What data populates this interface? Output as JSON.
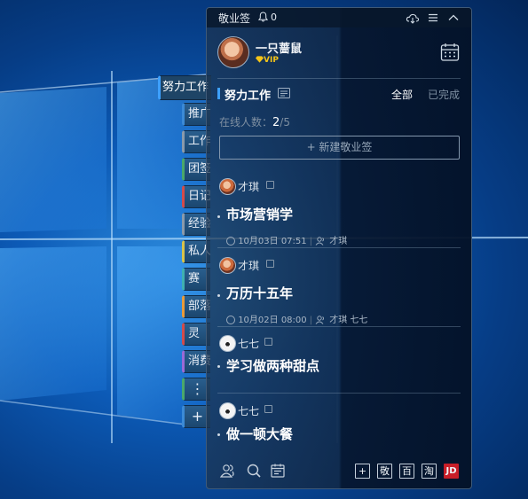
{
  "app": {
    "title": "敬业签",
    "notifications": "0"
  },
  "user": {
    "name": "一只蔷鼠",
    "badge": "VIP"
  },
  "category": {
    "title": "努力工作",
    "filter_all": "全部",
    "filter_done": "已完成"
  },
  "online": {
    "label": "在线人数：",
    "current": "2",
    "total": "/5"
  },
  "new_button": "+ 新建敬业签",
  "tabs": [
    {
      "label": "努力工作",
      "state": "active",
      "color": "#3da0ff"
    },
    {
      "label": "推广",
      "color": "#3b8ad6"
    },
    {
      "label": "工作",
      "color": "#8a9aab"
    },
    {
      "label": "团签",
      "color": "#4aa86b"
    },
    {
      "label": "日记",
      "color": "#d24b4b"
    },
    {
      "label": "经验",
      "color": "#8a9aab"
    },
    {
      "label": "私人",
      "color": "#d6c24a"
    },
    {
      "label": "赛",
      "color": "#3fb0b0"
    },
    {
      "label": "部落",
      "color": "#e89a3a"
    },
    {
      "label": "灵",
      "color": "#d24b4b"
    },
    {
      "label": "消费",
      "color": "#9a6ad6"
    },
    {
      "label": "⋮",
      "color": "#4aa86b"
    },
    {
      "label": "+",
      "color": "#3b8ad6"
    }
  ],
  "notes": [
    {
      "author": "才琪",
      "title": "市场营销学",
      "date": "10月03日 07:51",
      "assignees": "才琪"
    },
    {
      "author": "才琪",
      "title": "万历十五年",
      "date": "10月02日 08:00",
      "assignees": "才琪  七七"
    },
    {
      "author": "七七",
      "title": "学习做两种甜点"
    },
    {
      "author": "七七",
      "title": "做一顿大餐"
    }
  ],
  "footer": {
    "btn_plus": "+",
    "btn_jing": "敬",
    "btn_bai": "百",
    "btn_tao": "淘",
    "btn_jd": "JD"
  },
  "colors": {
    "accent": "#3da0ff",
    "vip": "#f5c518",
    "jd": "#c81e28"
  }
}
